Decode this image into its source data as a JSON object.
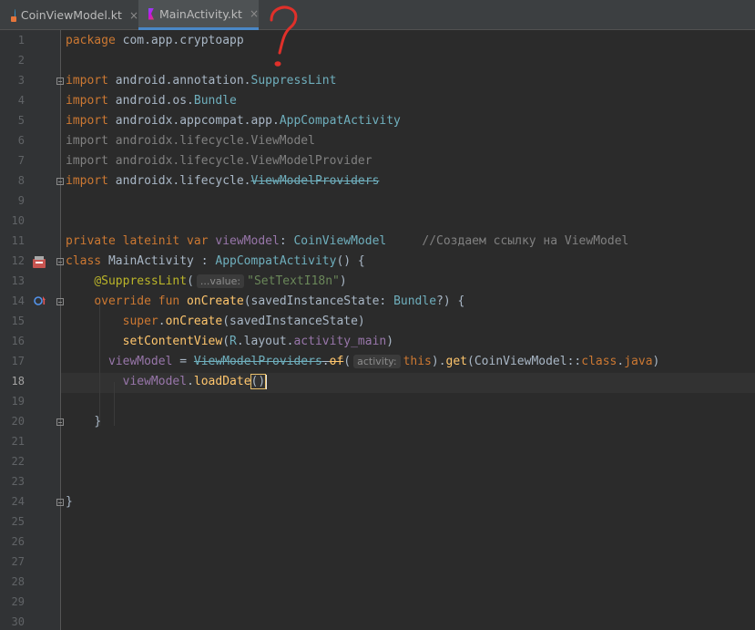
{
  "tabs": [
    {
      "label": "CoinViewModel.kt",
      "icon": "kotlin-class-icon",
      "close": "×"
    },
    {
      "label": "MainActivity.kt",
      "icon": "kotlin-file-icon",
      "close": "×"
    }
  ],
  "line_numbers": [
    "1",
    "2",
    "3",
    "4",
    "5",
    "6",
    "7",
    "8",
    "9",
    "10",
    "11",
    "12",
    "13",
    "14",
    "15",
    "16",
    "17",
    "18",
    "19",
    "20",
    "21",
    "22",
    "23",
    "24",
    "25",
    "26",
    "27",
    "28",
    "29",
    "30"
  ],
  "code": {
    "l1_kw": "package",
    "l1_rest": " com.app.cryptoapp",
    "import_kw": "import",
    "l3_pkg": " android.annotation.",
    "l3_cls": "SuppressLint",
    "l4_pkg": " android.os.",
    "l4_cls": "Bundle",
    "l5_pkg": " androidx.appcompat.app.",
    "l5_cls": "AppCompatActivity",
    "l6": "import androidx.lifecycle.ViewModel",
    "l7": "import androidx.lifecycle.ViewModelProvider",
    "l8_pkg": " androidx.lifecycle.",
    "l8_cls": "ViewModelProviders",
    "l11_kw": "private lateinit var",
    "l11_name": " viewModel",
    "l11_colon": ": ",
    "l11_type": "CoinViewModel",
    "l11_comment": "//Создаем ссылку на ViewModel",
    "l12_kw": "class",
    "l12_name": " MainActivity ",
    "l12_colon": ": ",
    "l12_type": "AppCompatActivity",
    "l12_tail": "() {",
    "l13_ann": "@SuppressLint",
    "l13_open": "(",
    "l13_hint": "...value:",
    "l13_str": "\"SetTextI18n\"",
    "l13_close": ")",
    "l14_kw": "override fun",
    "l14_fn": " onCreate",
    "l14_args": "(savedInstanceState: ",
    "l14_type": "Bundle",
    "l14_tail": "?) {",
    "l15_kw": "super",
    "l15_dot": ".",
    "l15_fn": "onCreate",
    "l15_args": "(savedInstanceState)",
    "l16_fn": "setContentView",
    "l16_open": "(",
    "l16_r": "R",
    "l16_mid": ".layout.",
    "l16_res": "activity_main",
    "l16_close": ")",
    "l17_var": "viewModel",
    "l17_eq": " = ",
    "l17_cls": "ViewModelProviders",
    "l17_dot": ".",
    "l17_of": "of",
    "l17_open": "(",
    "l17_hint": "activity:",
    "l17_this": "this",
    "l17_close": ").",
    "l17_get": "get",
    "l17_arg": "(CoinViewModel::",
    "l17_class": "class",
    "l17_dot2": ".",
    "l17_java": "java",
    "l17_end": ")",
    "l18_var": "viewModel",
    "l18_dot": ".",
    "l18_fn": "loadDate",
    "l18_parens": "()",
    "l20_brace": "}",
    "l24_brace": "}"
  },
  "annotation_mark": "?",
  "colors": {
    "background": "#2b2b2b",
    "keyword": "#cc7832",
    "class_ref": "#6fafbd",
    "string": "#6a8759",
    "annotation": "#bbb529",
    "function": "#ffc66d",
    "comment": "#808080",
    "handwriting": "#e0302a"
  }
}
